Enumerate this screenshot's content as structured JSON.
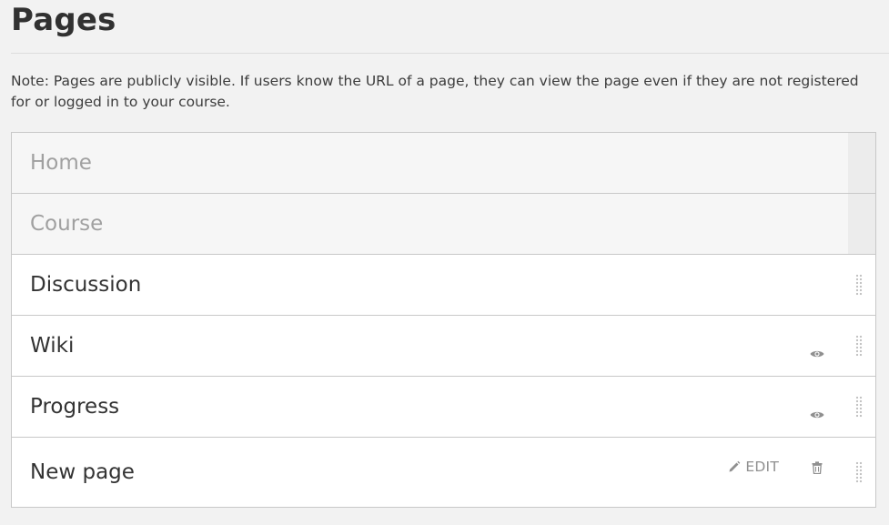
{
  "page": {
    "title": "Pages",
    "note": "Note: Pages are publicly visible. If users know the URL of a page, they can view the page even if they are not registered for or logged in to your course."
  },
  "pages": [
    {
      "label": "Home",
      "fixed": true
    },
    {
      "label": "Course",
      "fixed": true
    },
    {
      "label": "Discussion",
      "fixed": false
    },
    {
      "label": "Wiki",
      "fixed": false,
      "visibility_icon": "eye-icon"
    },
    {
      "label": "Progress",
      "fixed": false,
      "visibility_icon": "eye-icon"
    },
    {
      "label": "New page",
      "fixed": false,
      "edit_label": "EDIT",
      "delete_icon": "trash-icon"
    }
  ],
  "colors": {
    "background": "#f2f2f2",
    "border": "#c8c8c8",
    "fixed_text": "#a0a0a0",
    "text": "#333333",
    "icon": "#909090"
  }
}
